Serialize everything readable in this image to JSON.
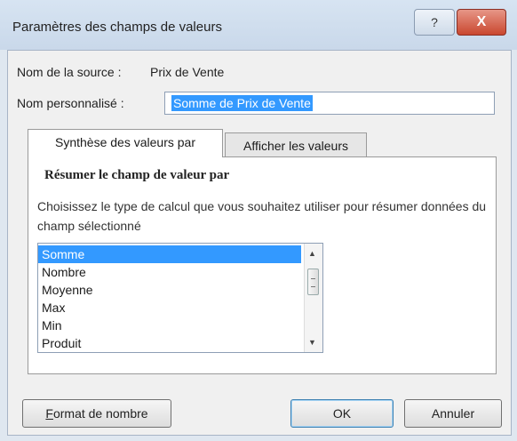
{
  "window": {
    "title": "Paramètres des champs de valeurs",
    "help_glyph": "?",
    "close_glyph": "X"
  },
  "source": {
    "label": "Nom de la source :",
    "value": "Prix de Vente"
  },
  "custom_name": {
    "label": "Nom personnalisé :",
    "value": "Somme de Prix de Vente"
  },
  "tabs": [
    {
      "label": "Synthèse des valeurs par",
      "active": true
    },
    {
      "label": "Afficher les valeurs",
      "active": false
    }
  ],
  "summarize": {
    "title": "Résumer le champ de valeur par",
    "description": "Choisissez le type de calcul que vous souhaitez utiliser pour résumer données du champ sélectionné",
    "items": [
      "Somme",
      "Nombre",
      "Moyenne",
      "Max",
      "Min",
      "Produit"
    ],
    "selected": "Somme"
  },
  "buttons": {
    "format": "Format de nombre",
    "ok": "OK",
    "cancel": "Annuler"
  },
  "colors": {
    "selection": "#3399ff",
    "close_button": "#c9472f"
  }
}
